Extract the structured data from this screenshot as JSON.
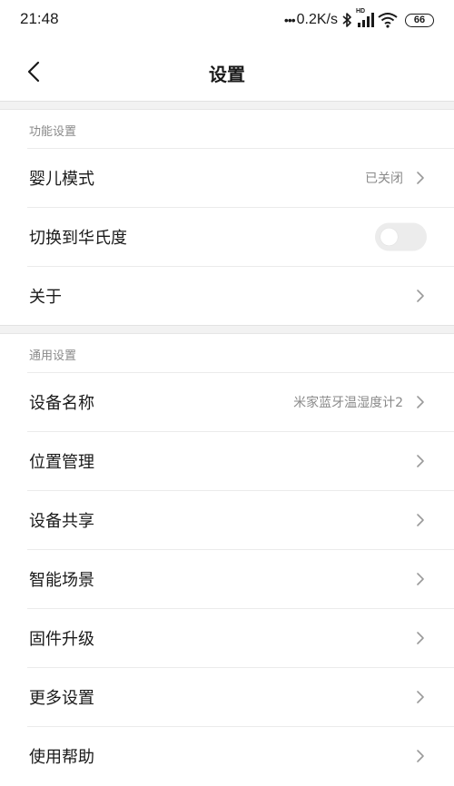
{
  "status_bar": {
    "time": "21:48",
    "dots": "•••",
    "speed": "0.2K/s",
    "hd": "HD",
    "battery": "66"
  },
  "header": {
    "title": "设置"
  },
  "sections": [
    {
      "title": "功能设置",
      "items": [
        {
          "label": "婴儿模式",
          "value": "已关闭",
          "control": "chevron"
        },
        {
          "label": "切换到华氏度",
          "control": "toggle",
          "toggle_on": false
        },
        {
          "label": "关于",
          "control": "chevron"
        }
      ]
    },
    {
      "title": "通用设置",
      "items": [
        {
          "label": "设备名称",
          "value": "米家蓝牙温湿度计2",
          "control": "chevron"
        },
        {
          "label": "位置管理",
          "control": "chevron"
        },
        {
          "label": "设备共享",
          "control": "chevron"
        },
        {
          "label": "智能场景",
          "control": "chevron"
        },
        {
          "label": "固件升级",
          "control": "chevron"
        },
        {
          "label": "更多设置",
          "control": "chevron"
        },
        {
          "label": "使用帮助",
          "control": "chevron"
        }
      ]
    }
  ],
  "colors": {
    "background": "#ffffff",
    "section_gap": "#f2f2f2",
    "secondary_text": "#8a8a8a",
    "toggle_off": "#ececec"
  }
}
